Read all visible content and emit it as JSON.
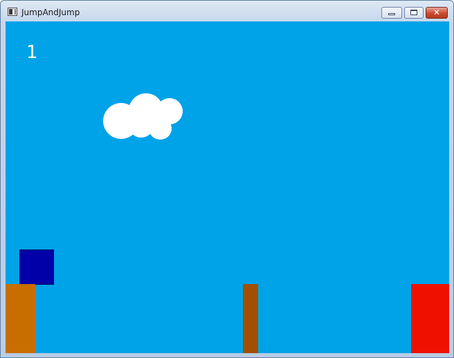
{
  "window": {
    "title": "JumpAndJump",
    "close_glyph": "✕"
  },
  "game": {
    "score": "1",
    "colors": {
      "sky": "#00a2e8",
      "cloud": "#ffffff",
      "player": "#0000a8",
      "platform_left": "#c86e00",
      "platform_middle": "#a05000",
      "platform_right": "#ee1100"
    }
  }
}
